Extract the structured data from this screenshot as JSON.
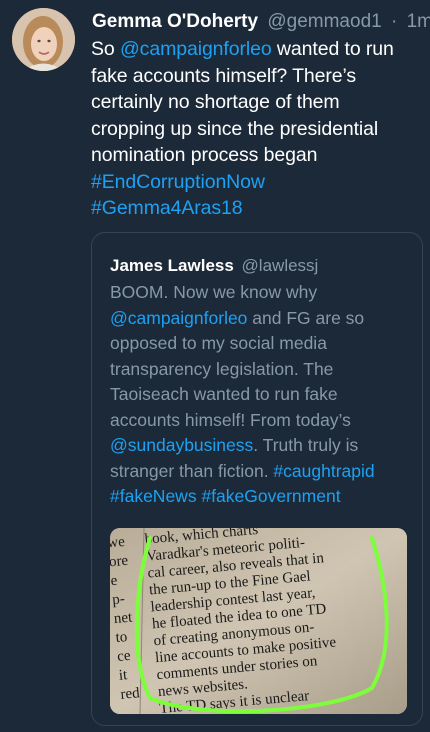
{
  "tweet": {
    "display_name": "Gemma O'Doherty",
    "handle": "@gemmaod1",
    "separator": "·",
    "time": "1m",
    "text_lines": [
      [
        {
          "t": "So ",
          "link": false
        },
        {
          "t": "@campaignforleo",
          "link": true
        },
        {
          "t": " wanted to run",
          "link": false
        }
      ],
      [
        {
          "t": "fake accounts himself? There’s",
          "link": false
        }
      ],
      [
        {
          "t": "certainly no shortage of them",
          "link": false
        }
      ],
      [
        {
          "t": "cropping up since the presidential",
          "link": false
        }
      ],
      [
        {
          "t": "nomination process began",
          "link": false
        }
      ],
      [
        {
          "t": "#EndCorruptionNow",
          "link": true
        }
      ],
      [
        {
          "t": "#Gemma4Aras18",
          "link": true
        }
      ]
    ]
  },
  "quote": {
    "display_name": "James Lawless",
    "handle": "@lawlessj",
    "text_lines": [
      [
        {
          "t": "BOOM. Now we know why",
          "link": false
        }
      ],
      [
        {
          "t": "@campaignforleo",
          "link": true
        },
        {
          "t": " and FG are so",
          "link": false
        }
      ],
      [
        {
          "t": "opposed to my social media",
          "link": false
        }
      ],
      [
        {
          "t": "transparency legislation. The",
          "link": false
        }
      ],
      [
        {
          "t": "Taoiseach wanted to run fake",
          "link": false
        }
      ],
      [
        {
          "t": "accounts himself! From today’s",
          "link": false
        }
      ],
      [
        {
          "t": "@sundaybusiness",
          "link": true
        },
        {
          "t": ". Truth truly is",
          "link": false
        }
      ],
      [
        {
          "t": "stranger than fiction. ",
          "link": false
        },
        {
          "t": "#caughtrapid",
          "link": true
        }
      ],
      [
        {
          "t": "#fakeNews",
          "link": true
        },
        {
          "t": " ",
          "link": false
        },
        {
          "t": "#fakeGovernment",
          "link": true
        }
      ]
    ],
    "image": {
      "left_column": [
        "we",
        "ore",
        "e",
        "p-",
        "net",
        "to",
        "ce",
        "it",
        "red"
      ],
      "main_lines": [
        "book, which charts",
        "Varadkar's meteoric politi-",
        "cal career, also reveals that in",
        "the run-up to the Fine Gael",
        "leadership contest last year,",
        "he floated the idea to one TD",
        "of creating anonymous on-",
        "line accounts to make positive",
        "comments under stories on",
        "news websites.",
        "The TD says it is unclear"
      ]
    }
  },
  "colors": {
    "background": "#1c2938",
    "text": "#ffffff",
    "secondary": "#8899a6",
    "link": "#1da1f2",
    "border": "#38444d",
    "highlight_circle": "#7cff3a"
  }
}
